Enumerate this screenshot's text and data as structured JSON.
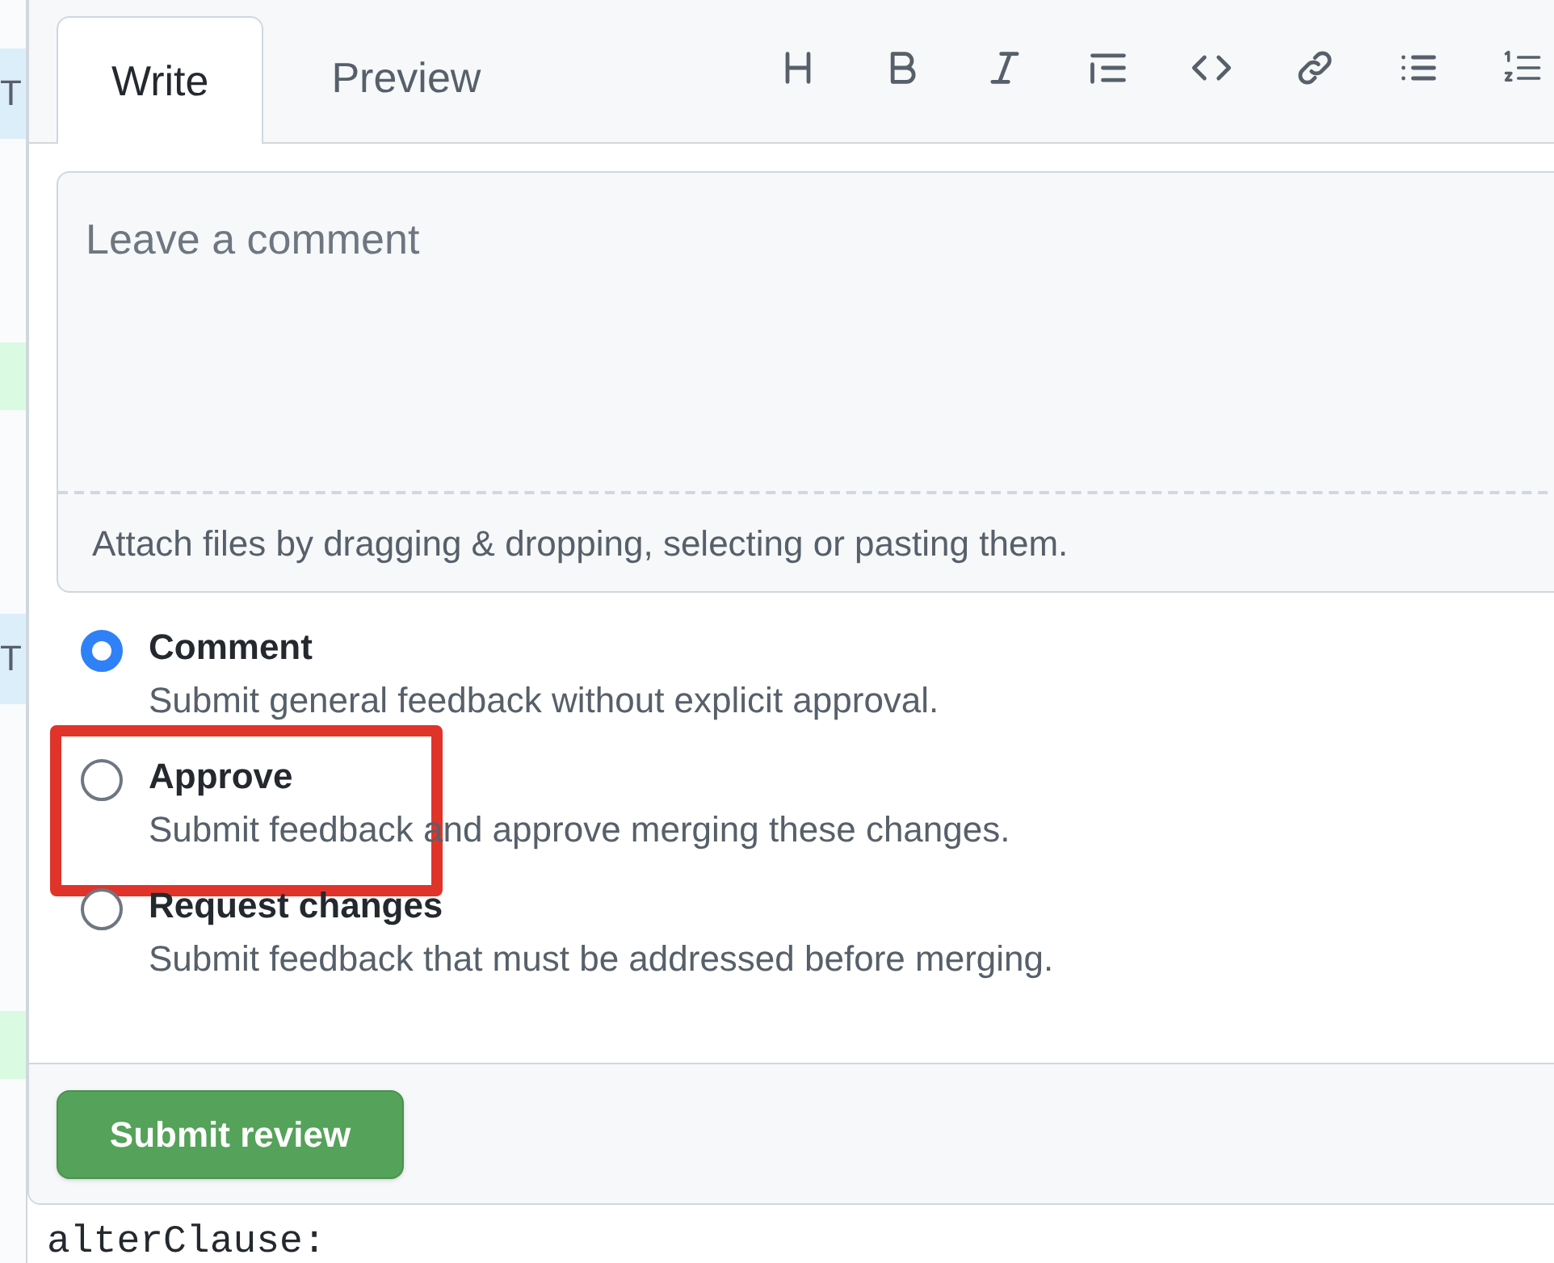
{
  "background_fragments": [
    "T",
    "T"
  ],
  "tabs": [
    {
      "label": "Write",
      "selected": true
    },
    {
      "label": "Preview",
      "selected": false
    }
  ],
  "toolbar": [
    {
      "kind": "heading"
    },
    {
      "kind": "bold"
    },
    {
      "kind": "italic"
    },
    {
      "kind": "quote"
    },
    {
      "kind": "code"
    },
    {
      "kind": "link"
    },
    {
      "kind": "bullets"
    },
    {
      "kind": "numbers"
    }
  ],
  "comment": {
    "placeholder": "Leave a comment",
    "attach_hint": "Attach files by dragging & dropping, selecting or pasting them."
  },
  "review_options": [
    {
      "label": "Comment",
      "description": "Submit general feedback without explicit approval.",
      "selected": true,
      "highlighted": false
    },
    {
      "label": "Approve",
      "description": "Submit feedback and approve merging these changes.",
      "selected": false,
      "highlighted": true
    },
    {
      "label": "Request changes",
      "description": "Submit feedback that must be addressed before merging.",
      "selected": false,
      "highlighted": false
    }
  ],
  "submit_button": "Submit review",
  "code_below": "alterClause:"
}
